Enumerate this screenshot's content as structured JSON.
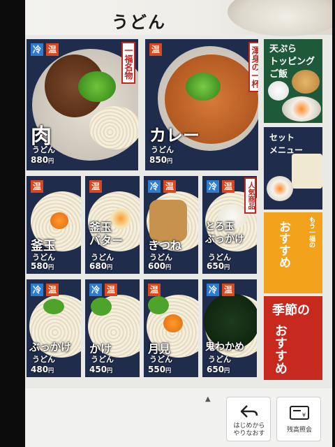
{
  "header": {
    "title": "うどん"
  },
  "badges": {
    "cold": "冷",
    "warm": "温"
  },
  "udon_word": "うどん",
  "price_suffix": "円",
  "items": [
    {
      "id": "niku",
      "name": "肉",
      "price": "880",
      "badges": [
        "冷",
        "温"
      ],
      "tag": "一福名物"
    },
    {
      "id": "curry",
      "name": "カレー",
      "price": "850",
      "badges": [
        "温"
      ],
      "tag": "渾身の一杯"
    },
    {
      "id": "kamatama",
      "name": "釜玉",
      "price": "580",
      "badges": [
        "温"
      ]
    },
    {
      "id": "kamatama-butter",
      "name": "釜玉\nバター",
      "price": "680",
      "badges": [
        "温"
      ]
    },
    {
      "id": "kitsune",
      "name": "きつね",
      "price": "600",
      "badges": [
        "冷",
        "温"
      ]
    },
    {
      "id": "torotama",
      "name": "とろ玉\nぶっかけ",
      "price": "650",
      "badges": [
        "冷",
        "温"
      ],
      "tag": "人気商品"
    },
    {
      "id": "bukkake",
      "name": "ぶっかけ",
      "price": "480",
      "badges": [
        "冷",
        "温"
      ]
    },
    {
      "id": "kake",
      "name": "かけ",
      "price": "450",
      "badges": [
        "冷",
        "温"
      ]
    },
    {
      "id": "tsukimi",
      "name": "月見",
      "price": "550",
      "badges": [
        "温"
      ]
    },
    {
      "id": "oniwakame",
      "name": "鬼わかめ",
      "price": "650",
      "badges": [
        "冷",
        "温"
      ]
    }
  ],
  "side": {
    "tempura": "天ぷら\nトッピング\nご飯",
    "set": "セット\nメニュー",
    "ichifuku_small": "もう一福の",
    "ichifuku": "おすすめ",
    "season_label": "季節の",
    "season": "おすすめ"
  },
  "footer": {
    "scroll_hint": "▲",
    "restart_label": "はじめから\nやりなおす",
    "balance_label": "残高照会"
  },
  "colors": {
    "card_bg": "#1f2c4c",
    "cold": "#2f7bd0",
    "warm": "#d9471f",
    "green": "#1e5a3a",
    "orange": "#f3a21c",
    "red": "#c8291e"
  }
}
